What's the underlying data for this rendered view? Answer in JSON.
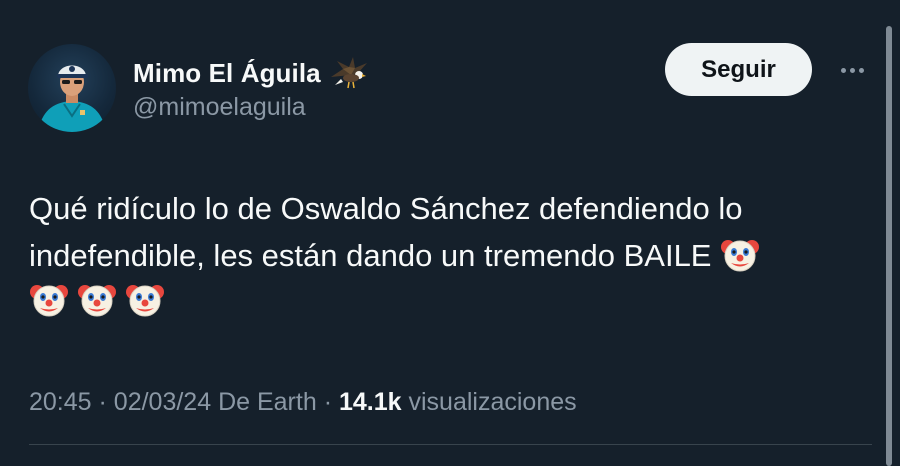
{
  "author": {
    "display_name": "Mimo El Águila",
    "handle": "@mimoelaguila",
    "avatar_icon": "avatar-photo",
    "badge_icon": "eagle-icon"
  },
  "follow_button": {
    "label": "Seguir"
  },
  "more_menu": {
    "icon": "more-horizontal-icon"
  },
  "tweet": {
    "text_line1": "Qué ridículo lo de Oswaldo Sánchez defendiendo lo",
    "text_line2": "indefendible, les están dando un tremendo BAILE",
    "emoji": "clown-face-icon",
    "emoji_count_line2": 1,
    "emoji_count_line3": 3
  },
  "meta": {
    "time": "20:45",
    "date": "02/03/24",
    "source": "De Earth",
    "separator": "·",
    "views_count": "14.1k",
    "views_label": "visualizaciones"
  },
  "colors": {
    "background": "#15202b",
    "text_primary": "#f7f9f9",
    "text_secondary": "#8b98a5",
    "button_bg": "#eff3f4"
  }
}
